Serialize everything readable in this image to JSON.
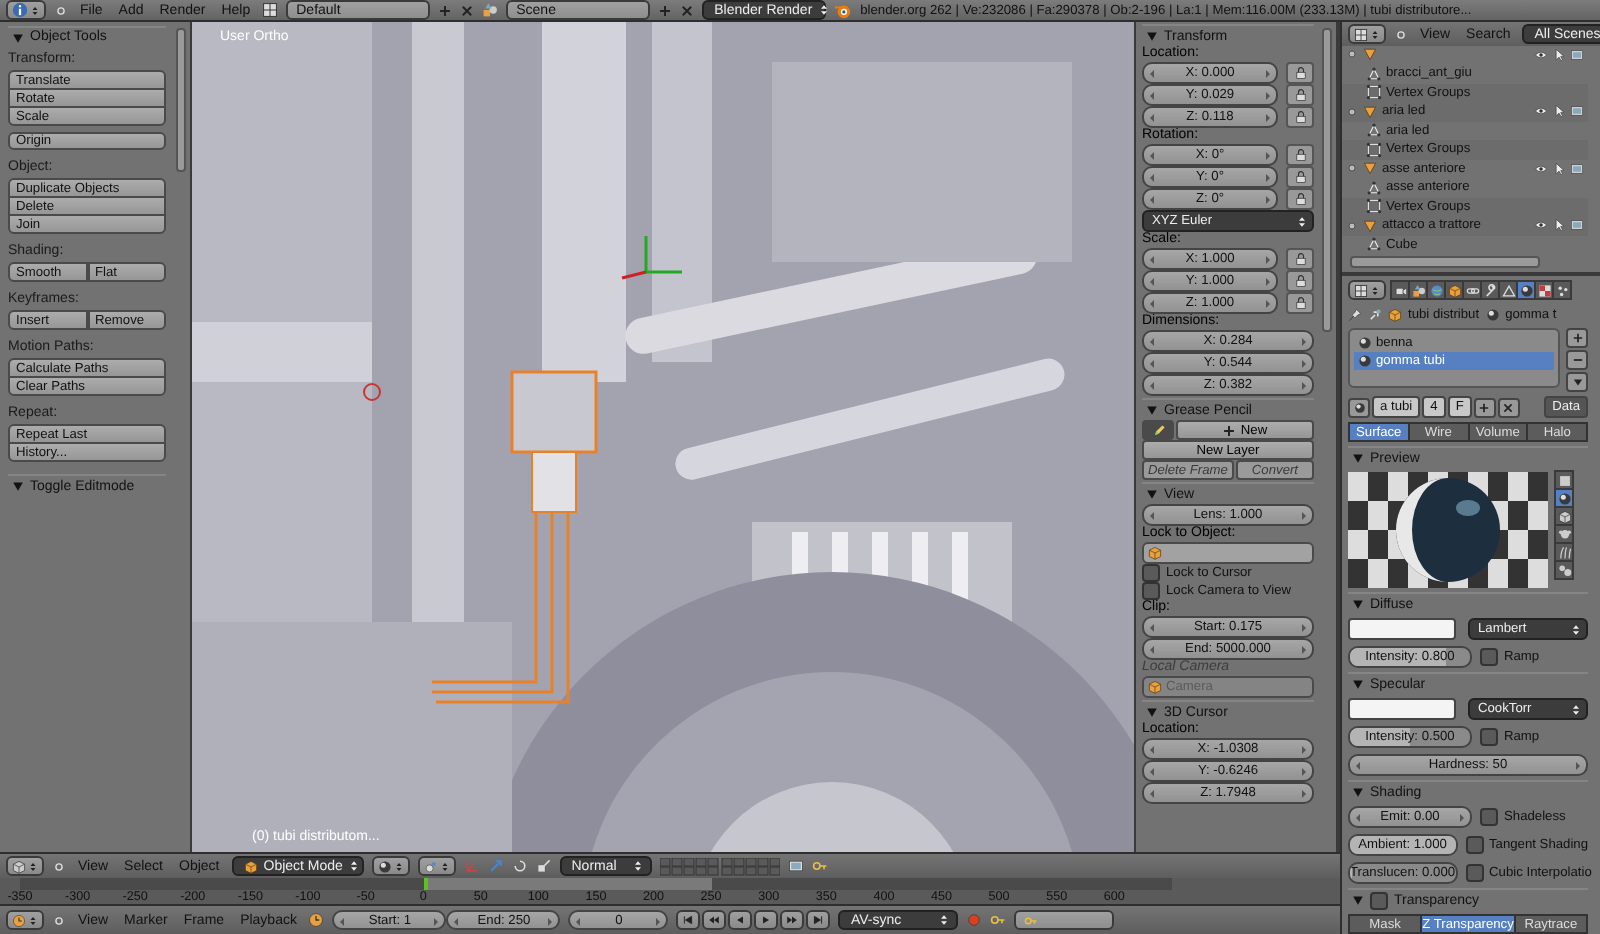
{
  "top_bar": {
    "menus": [
      "File",
      "Add",
      "Render",
      "Help"
    ],
    "layout": "Default",
    "scene": "Scene",
    "engine": "Blender Render",
    "stats": "blender.org 262 | Ve:232086 | Fa:290378 | Ob:2-196 | La:1 | Mem:116.00M (233.13M) | tubi distributore..."
  },
  "tool_shelf": {
    "title": "Object Tools",
    "expanded": true,
    "groups": [
      {
        "label": "Transform:",
        "rows": [
          [
            "Translate"
          ],
          [
            "Rotate"
          ],
          [
            "Scale"
          ]
        ],
        "extra": [
          "Origin"
        ]
      },
      {
        "label": "Object:",
        "rows": [
          [
            "Duplicate Objects"
          ],
          [
            "Delete"
          ],
          [
            "Join"
          ]
        ]
      },
      {
        "label": "Shading:",
        "rows": [
          [
            "Smooth",
            "Flat"
          ]
        ]
      },
      {
        "label": "Keyframes:",
        "rows": [
          [
            "Insert",
            "Remove"
          ]
        ]
      },
      {
        "label": "Motion Paths:",
        "rows": [
          [
            "Calculate Paths"
          ],
          [
            "Clear Paths"
          ]
        ]
      },
      {
        "label": "Repeat:",
        "rows": [
          [
            "Repeat Last"
          ],
          [
            "History..."
          ]
        ]
      }
    ],
    "footer": {
      "title": "Toggle Editmode",
      "expanded": true
    }
  },
  "viewport": {
    "view_name": "User Ortho",
    "object_label": "(0) tubi distributom..."
  },
  "properties_panel": {
    "sections": [
      {
        "title": "Transform",
        "expanded": true,
        "items": [
          {
            "kind": "label",
            "text": "Location:",
            "disabled": false
          },
          {
            "kind": "field",
            "text": "X: 0.000",
            "lock": true
          },
          {
            "kind": "field",
            "text": "Y: 0.029",
            "lock": true
          },
          {
            "kind": "field",
            "text": "Z: 0.118",
            "lock": true
          },
          {
            "kind": "label",
            "text": "Rotation:",
            "disabled": false
          },
          {
            "kind": "field",
            "text": "X: 0°",
            "lock": true
          },
          {
            "kind": "field",
            "text": "Y: 0°",
            "lock": true
          },
          {
            "kind": "field",
            "text": "Z: 0°",
            "lock": true
          },
          {
            "kind": "dropdown",
            "text": "XYZ Euler"
          },
          {
            "kind": "label",
            "text": "Scale:",
            "disabled": false
          },
          {
            "kind": "field",
            "text": "X: 1.000",
            "lock": true
          },
          {
            "kind": "field",
            "text": "Y: 1.000",
            "lock": true
          },
          {
            "kind": "field",
            "text": "Z: 1.000",
            "lock": true
          },
          {
            "kind": "label",
            "text": "Dimensions:",
            "disabled": false
          },
          {
            "kind": "field",
            "text": "X: 0.284",
            "lock": false
          },
          {
            "kind": "field",
            "text": "Y: 0.544",
            "lock": false
          },
          {
            "kind": "field",
            "text": "Z: 0.382",
            "lock": false
          }
        ]
      },
      {
        "title": "Grease Pencil",
        "expanded": true,
        "items": [
          {
            "kind": "buttons",
            "buttons": [
              {
                "kind": "draw",
                "disabled": false
              },
              {
                "kind": "add",
                "label": "New",
                "disabled": false
              }
            ]
          },
          {
            "kind": "buttons",
            "buttons": [
              {
                "label": "New Layer",
                "disabled": false
              }
            ]
          },
          {
            "kind": "buttons",
            "buttons": [
              {
                "label": "Delete Frame",
                "disabled": true
              },
              {
                "label": "Convert",
                "disabled": true
              }
            ]
          }
        ]
      },
      {
        "title": "View",
        "expanded": true,
        "items": [
          {
            "kind": "field",
            "text": "Lens: 1.000",
            "lock": false
          },
          {
            "kind": "label",
            "text": "Lock to Object:",
            "disabled": false
          },
          {
            "kind": "object_field",
            "disabled": false
          },
          {
            "kind": "checkbox",
            "label": "Lock to Cursor",
            "checked": false
          },
          {
            "kind": "checkbox",
            "label": "Lock Camera to View",
            "checked": false
          },
          {
            "kind": "label",
            "text": "Clip:",
            "disabled": false
          },
          {
            "kind": "field",
            "text": "Start: 0.175",
            "lock": false
          },
          {
            "kind": "field",
            "text": "End: 5000.000",
            "lock": false
          },
          {
            "kind": "label",
            "text": "Local Camera",
            "disabled": true
          },
          {
            "kind": "object_field",
            "text": "Camera",
            "disabled": true
          }
        ]
      },
      {
        "title": "3D Cursor",
        "expanded": true,
        "items": [
          {
            "kind": "label",
            "text": "Location:",
            "disabled": false
          },
          {
            "kind": "field",
            "text": "X: -1.0308",
            "lock": false
          },
          {
            "kind": "field",
            "text": "Y: -0.6246",
            "lock": false
          },
          {
            "kind": "field",
            "text": "Z: 1.7948",
            "lock": false
          }
        ]
      }
    ]
  },
  "view_header": {
    "menus": [
      "View",
      "Select",
      "Object"
    ],
    "mode": "Object Mode",
    "orientation": "Normal"
  },
  "timeline": {
    "ticks": [
      {
        "label": "-350",
        "in_range": false,
        "current": false
      },
      {
        "label": "-300",
        "in_range": false,
        "current": false
      },
      {
        "label": "-250",
        "in_range": false,
        "current": false
      },
      {
        "label": "-200",
        "in_range": false,
        "current": false
      },
      {
        "label": "-150",
        "in_range": false,
        "current": false
      },
      {
        "label": "-100",
        "in_range": false,
        "current": false
      },
      {
        "label": "-50",
        "in_range": false,
        "current": false
      },
      {
        "label": "0",
        "in_range": true,
        "current": true
      },
      {
        "label": "50",
        "in_range": true,
        "current": false
      },
      {
        "label": "100",
        "in_range": true,
        "current": false
      },
      {
        "label": "150",
        "in_range": true,
        "current": false
      },
      {
        "label": "200",
        "in_range": true,
        "current": false
      },
      {
        "label": "250",
        "in_range": false,
        "current": false
      },
      {
        "label": "300",
        "in_range": false,
        "current": false
      },
      {
        "label": "350",
        "in_range": false,
        "current": false
      },
      {
        "label": "400",
        "in_range": false,
        "current": false
      },
      {
        "label": "450",
        "in_range": false,
        "current": false
      },
      {
        "label": "500",
        "in_range": false,
        "current": false
      },
      {
        "label": "550",
        "in_range": false,
        "current": false
      },
      {
        "label": "600",
        "in_range": false,
        "current": false
      }
    ]
  },
  "timeline_header": {
    "menus": [
      "View",
      "Marker",
      "Frame",
      "Playback"
    ],
    "start": "Start: 1",
    "end": "End: 250",
    "frame": "0",
    "sync": "AV-sync"
  },
  "outliner": {
    "menus": [
      "View",
      "Search"
    ],
    "scene_filter": "All Scenes",
    "tree": [
      {
        "kind": "object",
        "children": [
          {
            "name": "bracci_ant_giu",
            "kind": "mesh"
          },
          {
            "name": "Vertex Groups",
            "kind": "vgroup"
          }
        ]
      },
      {
        "name": "aria led",
        "kind": "object",
        "children": [
          {
            "name": "aria led",
            "kind": "mesh"
          },
          {
            "name": "Vertex Groups",
            "kind": "vgroup"
          }
        ]
      },
      {
        "name": "asse anteriore",
        "kind": "object",
        "children": [
          {
            "name": "asse anteriore",
            "kind": "mesh"
          },
          {
            "name": "Vertex Groups",
            "kind": "vgroup"
          }
        ]
      },
      {
        "name": "attacco a trattore",
        "kind": "object",
        "children": [
          {
            "name": "Cube",
            "kind": "mesh"
          }
        ]
      }
    ]
  },
  "properties_editor": {
    "context_tabs": [
      {
        "kind": "camera",
        "selected": false
      },
      {
        "kind": "shapes",
        "selected": false
      },
      {
        "kind": "globe",
        "selected": false
      },
      {
        "kind": "cube",
        "selected": false
      },
      {
        "kind": "chain",
        "selected": false
      },
      {
        "kind": "wrench",
        "selected": false
      },
      {
        "kind": "triangle",
        "selected": false
      },
      {
        "kind": "sphere",
        "selected": true
      },
      {
        "kind": "checker",
        "selected": false
      },
      {
        "kind": "dots",
        "selected": false
      }
    ],
    "breadcrumb": [
      "tubi distribut",
      "gomma t"
    ],
    "materials": [
      {
        "name": "benna",
        "selected": false
      },
      {
        "name": "gomma tubi",
        "selected": true
      }
    ],
    "datablock": {
      "name": "a tubi",
      "users": "4",
      "fake_user": "F",
      "link": "Data"
    },
    "tabs": [
      {
        "label": "Surface",
        "selected": true
      },
      {
        "label": "Wire",
        "selected": false
      },
      {
        "label": "Volume",
        "selected": false
      },
      {
        "label": "Halo",
        "selected": false
      }
    ],
    "panels": [
      {
        "kind": "preview",
        "title": "Preview",
        "expanded": true,
        "shapes": [
          {
            "kind": "plane",
            "selected": false
          },
          {
            "kind": "sphere",
            "selected": true
          },
          {
            "kind": "cube",
            "selected": false
          },
          {
            "kind": "head",
            "selected": false
          },
          {
            "kind": "strands",
            "selected": false
          },
          {
            "kind": "balls",
            "selected": false
          }
        ]
      },
      {
        "kind": "rows",
        "title": "Diffuse",
        "expanded": true,
        "rows": [
          {
            "kind": "color",
            "dropdown": "Lambert"
          },
          {
            "kind": "field_check",
            "field": {
              "kind": "slider",
              "text": "Intensity: 0.800",
              "level": 0.8
            },
            "checkbox": {
              "label": "Ramp",
              "checked": false
            }
          }
        ]
      },
      {
        "kind": "rows",
        "title": "Specular",
        "expanded": true,
        "rows": [
          {
            "kind": "color",
            "dropdown": "CookTorr"
          },
          {
            "kind": "field_check",
            "field": {
              "kind": "slider",
              "text": "Intensity: 0.500",
              "level": 0.5
            },
            "checkbox": {
              "label": "Ramp",
              "checked": false
            }
          },
          {
            "kind": "field",
            "field": {
              "kind": "number",
              "text": "Hardness: 50"
            }
          }
        ]
      },
      {
        "kind": "rows",
        "title": "Shading",
        "expanded": true,
        "rows": [
          {
            "kind": "field_check",
            "field": {
              "kind": "number",
              "text": "Emit: 0.00"
            },
            "checkbox": {
              "label": "Shadeless",
              "checked": false
            }
          },
          {
            "kind": "field_check",
            "field": {
              "kind": "slider",
              "text": "Ambient: 1.000",
              "level": 1
            },
            "checkbox": {
              "label": "Tangent Shading",
              "checked": false
            }
          },
          {
            "kind": "field_check",
            "field": {
              "kind": "slider",
              "text": "Translucen: 0.000",
              "level": 0
            },
            "checkbox": {
              "label": "Cubic Interpolatio",
              "checked": false
            }
          }
        ]
      },
      {
        "kind": "tabs",
        "title": "Transparency",
        "expanded": true,
        "enabled": false,
        "tabs": [
          {
            "label": "Mask",
            "selected": false
          },
          {
            "label": "Z Transparency",
            "selected": true
          },
          {
            "label": "Raytrace",
            "selected": false
          }
        ]
      }
    ]
  }
}
